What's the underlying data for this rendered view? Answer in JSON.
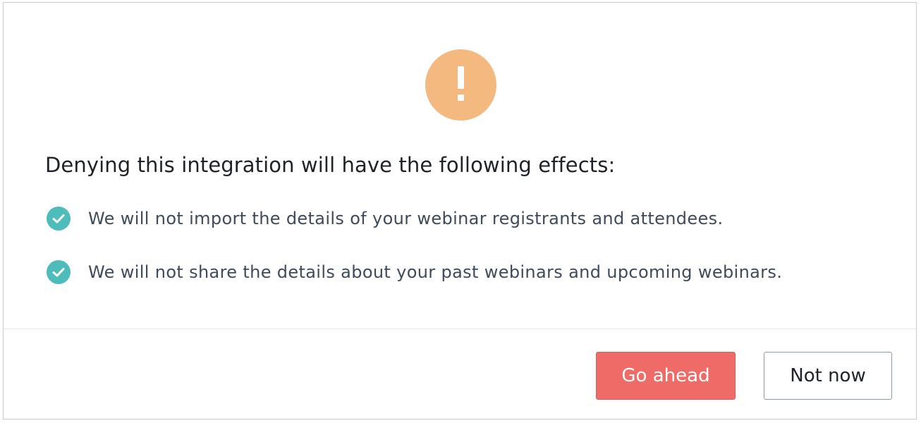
{
  "colors": {
    "warning": "#f4b97e",
    "check": "#4fbcbc",
    "primary_button": "#ee6b67"
  },
  "icons": {
    "warning": "exclamation-circle",
    "check": "check-circle"
  },
  "dialog": {
    "heading": "Denying this integration will have the following effects:",
    "effects": [
      {
        "text": "We will not import the details of your webinar registrants and attendees."
      },
      {
        "text": "We will not share the details about your past webinars and upcoming webinars."
      }
    ],
    "buttons": {
      "primary": "Go ahead",
      "secondary": "Not now"
    }
  }
}
